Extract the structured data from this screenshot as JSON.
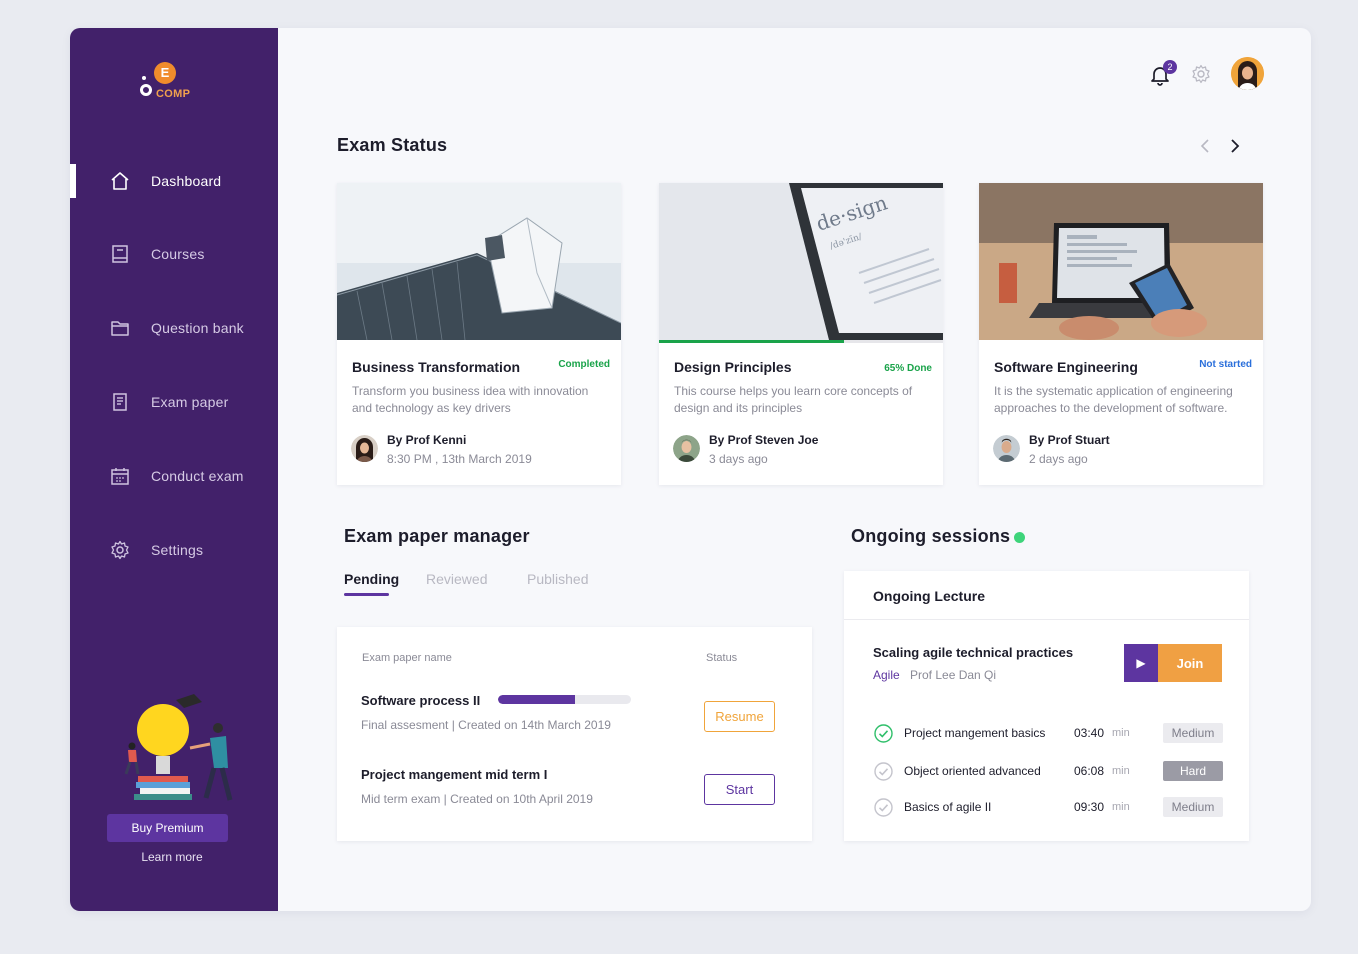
{
  "app": {
    "logo_letter": "E",
    "logo_text": "COMP"
  },
  "sidebar": {
    "items": [
      {
        "label": "Dashboard",
        "icon": "home-icon",
        "active": true
      },
      {
        "label": "Courses",
        "icon": "book-icon"
      },
      {
        "label": "Question bank",
        "icon": "folder-icon"
      },
      {
        "label": "Exam paper",
        "icon": "document-icon"
      },
      {
        "label": "Conduct exam",
        "icon": "calendar-icon"
      },
      {
        "label": "Settings",
        "icon": "gear-icon"
      }
    ],
    "buy_label": "Buy Premium",
    "learn_label": "Learn more"
  },
  "header": {
    "notification_count": "2"
  },
  "exam_status": {
    "title": "Exam Status",
    "cards": [
      {
        "title": "Business Transformation",
        "status": "Completed",
        "status_color": "#1aa34a",
        "description": "Transform you business idea with innovation and technology as key drivers",
        "author": "By Prof Kenni",
        "when": "8:30 PM , 13th March 2019"
      },
      {
        "title": "Design Principles",
        "status": "65% Done",
        "status_color": "#1aa34a",
        "progress": 0.65,
        "description": "This course helps you learn core concepts of design and its principles",
        "author": "By Prof Steven Joe",
        "when": "3 days ago"
      },
      {
        "title": "Software Engineering",
        "status": "Not started",
        "status_color": "#2a6fdb",
        "description": "It is the systematic application of engineering approaches to the development of software.",
        "author": "By Prof Stuart",
        "when": "2 days ago"
      }
    ]
  },
  "exam_paper_manager": {
    "title": "Exam paper manager",
    "tabs": [
      "Pending",
      "Reviewed",
      "Published"
    ],
    "col_name": "Exam paper name",
    "col_status": "Status",
    "rows": [
      {
        "name": "Software process II",
        "meta": "Final assesment  |  Created on 14th March 2019",
        "progress": 0.58,
        "action": "Resume"
      },
      {
        "name": "Project mangement mid term I",
        "meta": "Mid term exam  |  Created on 10th April 2019",
        "action": "Start"
      }
    ]
  },
  "ongoing": {
    "title": "Ongoing sessions",
    "panel_title": "Ongoing Lecture",
    "lecture_name": "Scaling agile technical practices",
    "lecture_tag": "Agile",
    "lecture_prof": "Prof Lee Dan Qi",
    "join_label": "Join",
    "topics": [
      {
        "name": "Project mangement basics",
        "time": "03:40",
        "unit": "min",
        "level": "Medium",
        "done": true
      },
      {
        "name": "Object oriented advanced",
        "time": "06:08",
        "unit": "min",
        "level": "Hard",
        "done": false
      },
      {
        "name": "Basics of agile II",
        "time": "09:30",
        "unit": "min",
        "level": "Medium",
        "done": false
      }
    ]
  }
}
